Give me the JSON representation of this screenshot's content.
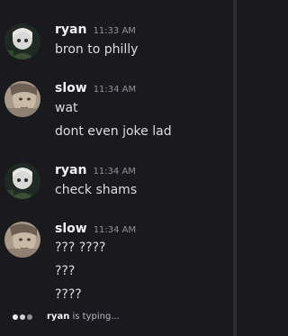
{
  "messages": [
    {
      "username": "ryan",
      "time": "11:33 AM",
      "avatar_icon": "anime-face-avatar-dark",
      "lines": [
        "bron to philly"
      ]
    },
    {
      "username": "slow",
      "time": "11:34 AM",
      "avatar_icon": "sepia-face-avatar",
      "lines": [
        "wat",
        "dont even joke lad"
      ]
    },
    {
      "username": "ryan",
      "time": "11:34 AM",
      "avatar_icon": "anime-face-avatar-dark",
      "lines": [
        "check shams"
      ]
    },
    {
      "username": "slow",
      "time": "11:34 AM",
      "avatar_icon": "sepia-face-avatar",
      "lines": [
        "??? ????",
        "???",
        "????"
      ]
    }
  ],
  "typing": {
    "user": "ryan",
    "suffix": " is typing..."
  },
  "colors": {
    "background": "#1a1a1e",
    "username": "#f2f3f5",
    "timestamp": "#8e9297",
    "text": "#dbdee1"
  }
}
